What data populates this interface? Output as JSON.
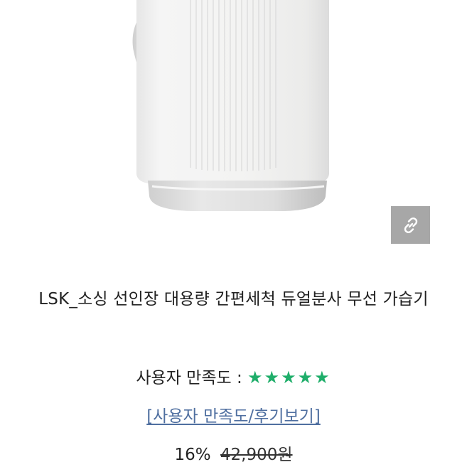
{
  "product": {
    "title": "LSK_소싱 선인장 대용량 간편세척 듀얼분사 무선 가습기",
    "rating_label": "사용자 만족도 :",
    "rating_stars": "★★★★★",
    "rating_value": 5,
    "review_link": "[사용자 만족도/후기보기]",
    "discount": "16%",
    "original_price": "42,900원"
  },
  "icons": {
    "link_button_icon": "link-chain-icon"
  },
  "colors": {
    "star": "#1fae6a",
    "review_link": "#4f6fa0",
    "link_button_bg": "#a7a7a7"
  }
}
